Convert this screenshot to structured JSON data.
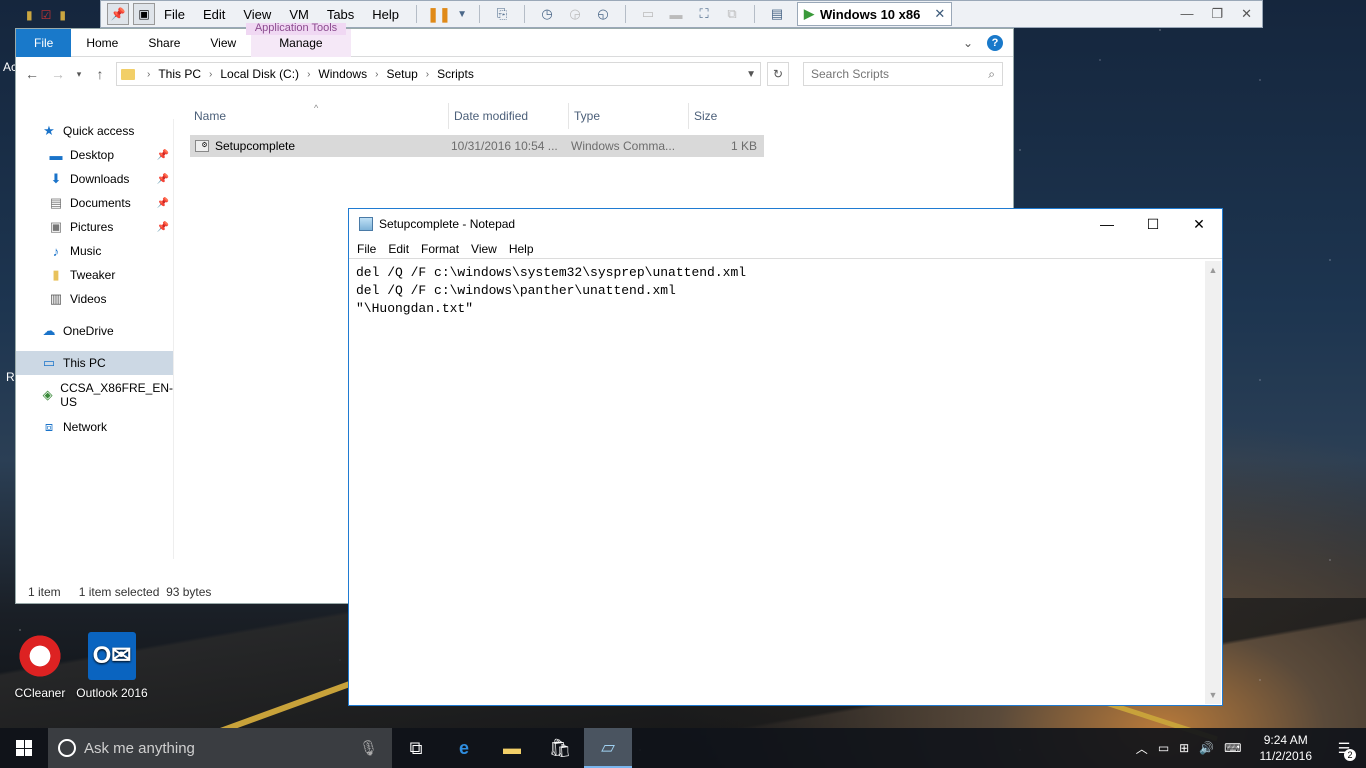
{
  "vmware": {
    "menus": [
      "File",
      "Edit",
      "View",
      "VM",
      "Tabs",
      "Help"
    ],
    "tab_title": "Windows 10 x86"
  },
  "explorer": {
    "ribbon_tabs": {
      "file": "File",
      "home": "Home",
      "share": "Share",
      "view": "View",
      "manage": "Manage"
    },
    "contextual_group": "Application Tools",
    "breadcrumb": [
      "This PC",
      "Local Disk (C:)",
      "Windows",
      "Setup",
      "Scripts"
    ],
    "search_placeholder": "Search Scripts",
    "nav": {
      "quick_access": "Quick access",
      "desktop": "Desktop",
      "downloads": "Downloads",
      "documents": "Documents",
      "pictures": "Pictures",
      "music": "Music",
      "tweaker": "Tweaker",
      "videos": "Videos",
      "onedrive": "OneDrive",
      "this_pc": "This PC",
      "drive": "CCSA_X86FRE_EN-US",
      "network": "Network"
    },
    "columns": {
      "name": "Name",
      "date": "Date modified",
      "type": "Type",
      "size": "Size"
    },
    "files": [
      {
        "name": "Setupcomplete",
        "date": "10/31/2016 10:54 ...",
        "type": "Windows Comma...",
        "size": "1 KB"
      }
    ],
    "status": {
      "count": "1 item",
      "selected": "1 item selected  93 bytes"
    }
  },
  "notepad": {
    "title": "Setupcomplete - Notepad",
    "menus": [
      "File",
      "Edit",
      "Format",
      "View",
      "Help"
    ],
    "lines": [
      "del /Q /F c:\\windows\\system32\\sysprep\\unattend.xml",
      "del /Q /F c:\\windows\\panther\\unattend.xml",
      "\"\\Huongdan.txt\""
    ]
  },
  "desktop": {
    "icons": [
      {
        "label": "CCleaner"
      },
      {
        "label": "Outlook 2016"
      }
    ],
    "edge_texts": [
      "Ac",
      "R"
    ]
  },
  "taskbar": {
    "search_placeholder": "Ask me anything",
    "time": "9:24 AM",
    "date": "11/2/2016",
    "notifications": "2"
  }
}
